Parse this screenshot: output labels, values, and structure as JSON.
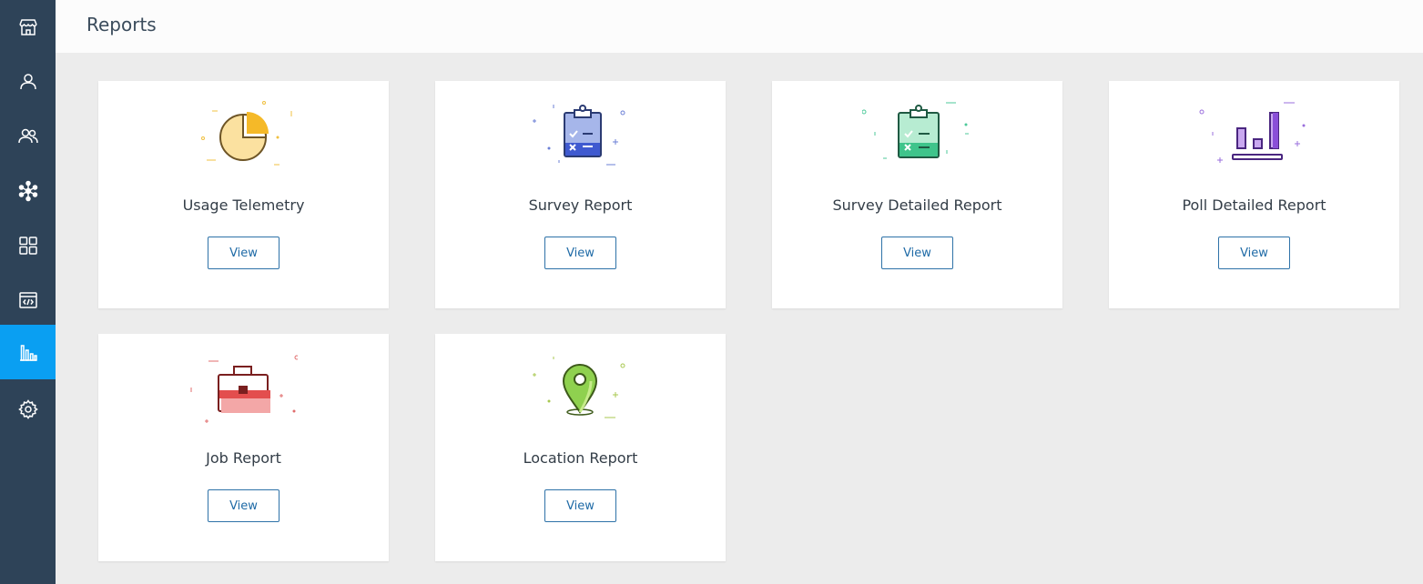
{
  "header": {
    "title": "Reports"
  },
  "sidebar": {
    "items": [
      {
        "icon": "store-icon",
        "active": false
      },
      {
        "icon": "user-icon",
        "active": false
      },
      {
        "icon": "users-icon",
        "active": false
      },
      {
        "icon": "network-icon",
        "active": false
      },
      {
        "icon": "grid-icon",
        "active": false
      },
      {
        "icon": "code-window-icon",
        "active": false
      },
      {
        "icon": "bar-chart-icon",
        "active": true
      },
      {
        "icon": "gear-icon",
        "active": false
      }
    ]
  },
  "cards": [
    {
      "title": "Usage Telemetry",
      "button": "View",
      "icon": "pie-chart-illustration"
    },
    {
      "title": "Survey Report",
      "button": "View",
      "icon": "clipboard-blue-illustration"
    },
    {
      "title": "Survey Detailed Report",
      "button": "View",
      "icon": "clipboard-green-illustration"
    },
    {
      "title": "Poll Detailed Report",
      "button": "View",
      "icon": "bar-chart-purple-illustration"
    },
    {
      "title": "Job Report",
      "button": "View",
      "icon": "briefcase-illustration"
    },
    {
      "title": "Location Report",
      "button": "View",
      "icon": "location-pin-illustration"
    }
  ],
  "colors": {
    "sidebar_bg": "#2e4358",
    "active_accent": "#0a9ff2",
    "button_border": "#2e72a8"
  }
}
